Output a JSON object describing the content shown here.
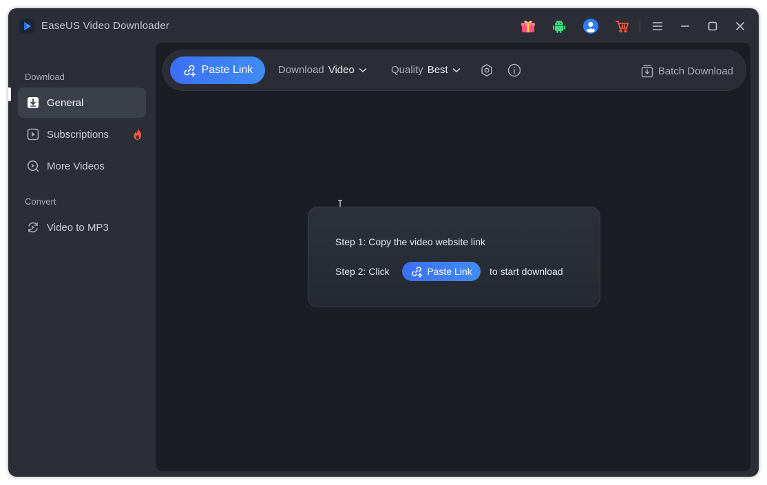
{
  "window": {
    "title": "EaseUS Video Downloader"
  },
  "titlebar": {
    "icons": [
      "gift-icon",
      "android-icon",
      "user-icon",
      "cart-icon",
      "menu-icon",
      "minimize-icon",
      "maximize-icon",
      "close-icon"
    ]
  },
  "sidebar": {
    "download_section": "Download",
    "convert_section": "Convert",
    "items": [
      {
        "label": "General",
        "icon": "download-box-icon",
        "active": true
      },
      {
        "label": "Subscriptions",
        "icon": "play-box-icon",
        "badge": "fire-icon"
      },
      {
        "label": "More Videos",
        "icon": "search-play-icon"
      },
      {
        "label": "Video to MP3",
        "icon": "convert-icon"
      }
    ]
  },
  "toolbar": {
    "paste_label": "Paste Link",
    "download_label": "Download",
    "download_value": "Video",
    "quality_label": "Quality",
    "quality_value": "Best",
    "batch_label": "Batch Download"
  },
  "steps": {
    "step1": "Step 1: Copy the video website link",
    "step2_prefix": "Step 2: Click",
    "step2_button": "Paste Link",
    "step2_suffix": "to start download"
  },
  "colors": {
    "accent": "#3d6ff5",
    "window_bg": "#2b2e37",
    "main_bg": "#1b1d24",
    "fire": "#ff5a3a"
  }
}
